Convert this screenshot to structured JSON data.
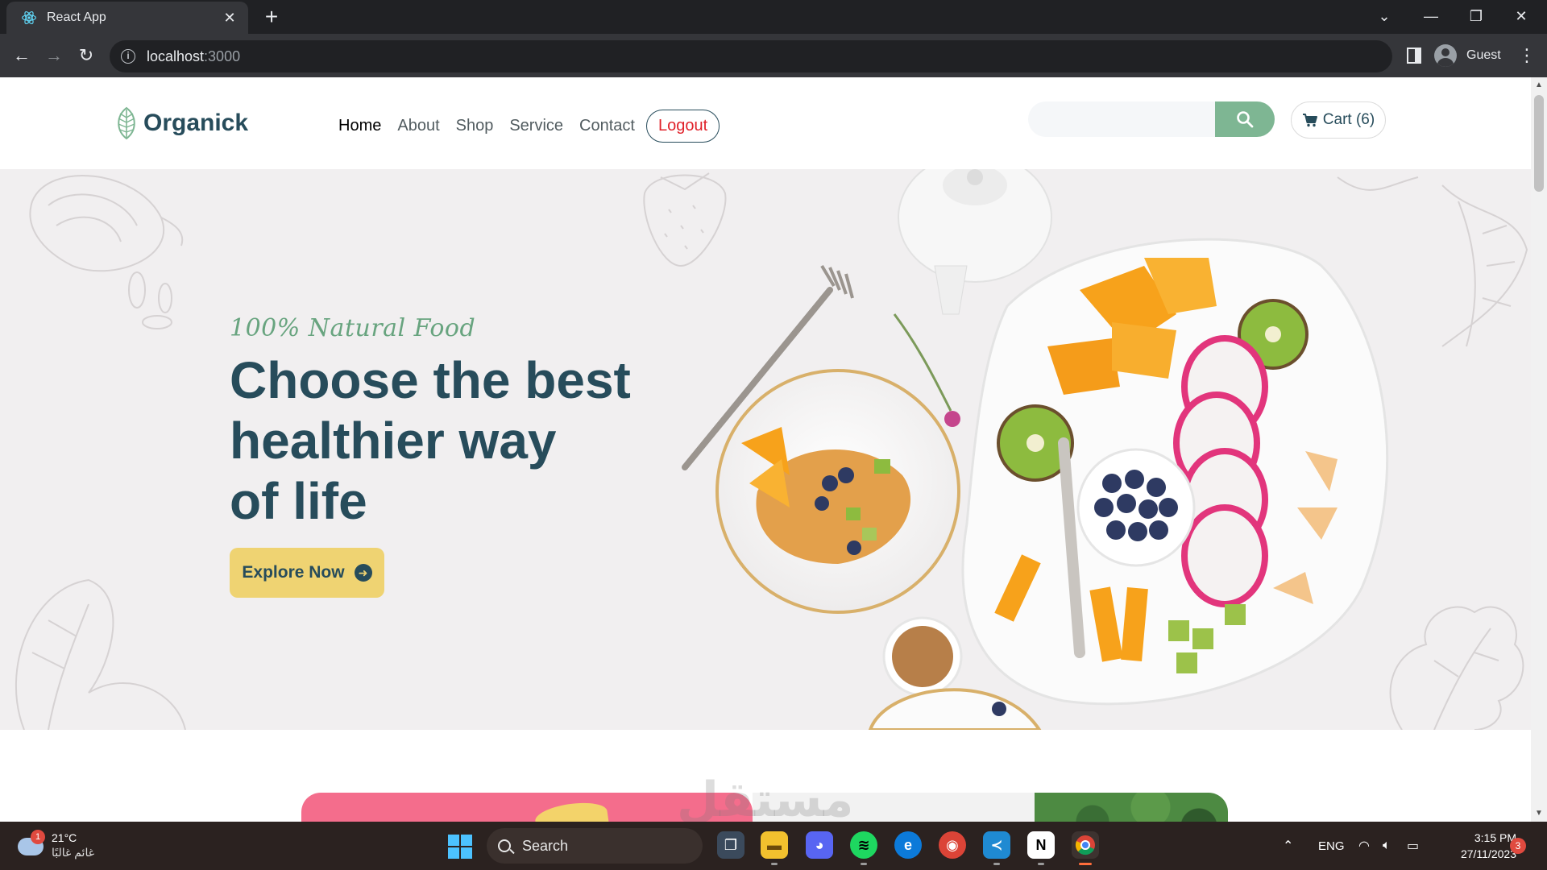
{
  "browser": {
    "tab_title": "React App",
    "url_host": "localhost",
    "url_port": ":3000",
    "profile_name": "Guest"
  },
  "site": {
    "brand": "Organick",
    "nav": [
      {
        "label": "Home",
        "active": true
      },
      {
        "label": "About",
        "active": false
      },
      {
        "label": "Shop",
        "active": false
      },
      {
        "label": "Service",
        "active": false
      },
      {
        "label": "Contact",
        "active": false
      }
    ],
    "logout_label": "Logout",
    "search_placeholder": "",
    "cart_label": "Cart (6)",
    "colors": {
      "primary": "#274c5b",
      "green": "#7eb693",
      "yellow": "#efd372",
      "logout_red": "#e0222a"
    }
  },
  "hero": {
    "tagline": "100% Natural Food",
    "headline_lines": [
      "Choose the best",
      "healthier way",
      "of life"
    ],
    "cta_label": "Explore Now"
  },
  "watermark": "مستقل",
  "taskbar": {
    "weather_temp": "21°C",
    "weather_condition": "غائم غالبًا",
    "weather_badge": "1",
    "search_label": "Search",
    "lang": "ENG",
    "time": "3:15 PM",
    "date": "27/11/2023",
    "notification_count": "3",
    "apps": [
      "file-explorer-icon",
      "discord-icon",
      "spotify-icon",
      "edge-icon",
      "chrome-profile-icon",
      "vscode-icon",
      "notion-icon",
      "chrome-icon"
    ]
  }
}
